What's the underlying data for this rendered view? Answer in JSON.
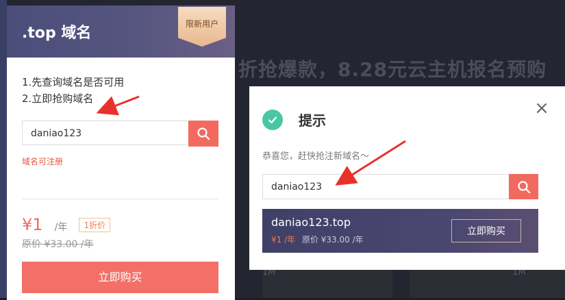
{
  "background": {
    "banner_text": "折抢爆款，8.28元云主机报名预购",
    "bottom_left_text": "1M",
    "bottom_right_text": "1M"
  },
  "card": {
    "title": ".top 域名",
    "ribbon": "限新用户",
    "steps": [
      "1.先查询域名是否可用",
      "2.立即抢购域名"
    ],
    "search_value": "daniao123",
    "status": "域名可注册",
    "price": "¥1",
    "per": "/年",
    "discount": "1折价",
    "original_price": "原价 ¥33.00 /年",
    "buy_label": "立即购买"
  },
  "dialog": {
    "title": "提示",
    "message": "恭喜您，赶快抢注新域名～",
    "search_value": "daniao123",
    "result": {
      "domain": "daniao123.top",
      "price": "¥1 /年",
      "original_price": "原价 ¥33.00 /年",
      "buy_label": "立即购买"
    }
  },
  "colors": {
    "accent": "#f26a5f",
    "success": "#47c8a3",
    "header": "#4b4e7a"
  },
  "icons": {
    "search": "search-icon",
    "success": "check-circle-icon",
    "close": "close-icon"
  }
}
